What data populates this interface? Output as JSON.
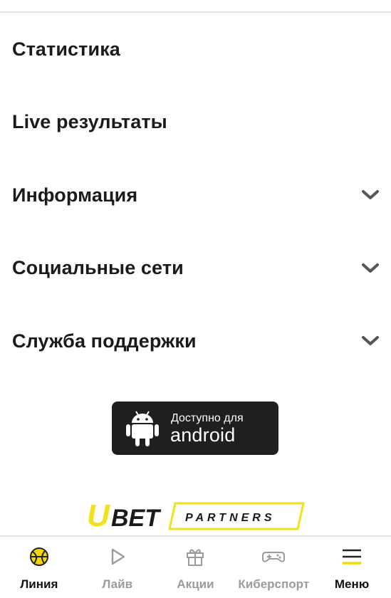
{
  "menu": {
    "items": [
      {
        "label": "Статистика",
        "expandable": false
      },
      {
        "label": "Live результаты",
        "expandable": false
      },
      {
        "label": "Информация",
        "expandable": true
      },
      {
        "label": "Социальные сети",
        "expandable": true
      },
      {
        "label": "Служба поддержки",
        "expandable": true
      }
    ],
    "chevron_icon": "chevron-down-icon"
  },
  "android_badge": {
    "small_text": "Доступно для",
    "big_text": "android",
    "icon": "android-robot-icon"
  },
  "partners_logo": {
    "text_u": "U",
    "text_bet": "BET",
    "text_partners": "PARTNERS",
    "accent_color": "#f2e21a"
  },
  "tabbar": {
    "tabs": [
      {
        "label": "Линия",
        "icon": "ball-icon",
        "active": true
      },
      {
        "label": "Лайв",
        "icon": "play-icon",
        "active": false
      },
      {
        "label": "Акции",
        "icon": "gift-icon",
        "active": false
      },
      {
        "label": "Киберспорт",
        "icon": "gamepad-icon",
        "active": false
      },
      {
        "label": "Меню",
        "icon": "menu-icon",
        "active": true
      }
    ],
    "active_color": "#111111",
    "inactive_color": "#9b9b9b",
    "accent_color": "#f5d800"
  }
}
